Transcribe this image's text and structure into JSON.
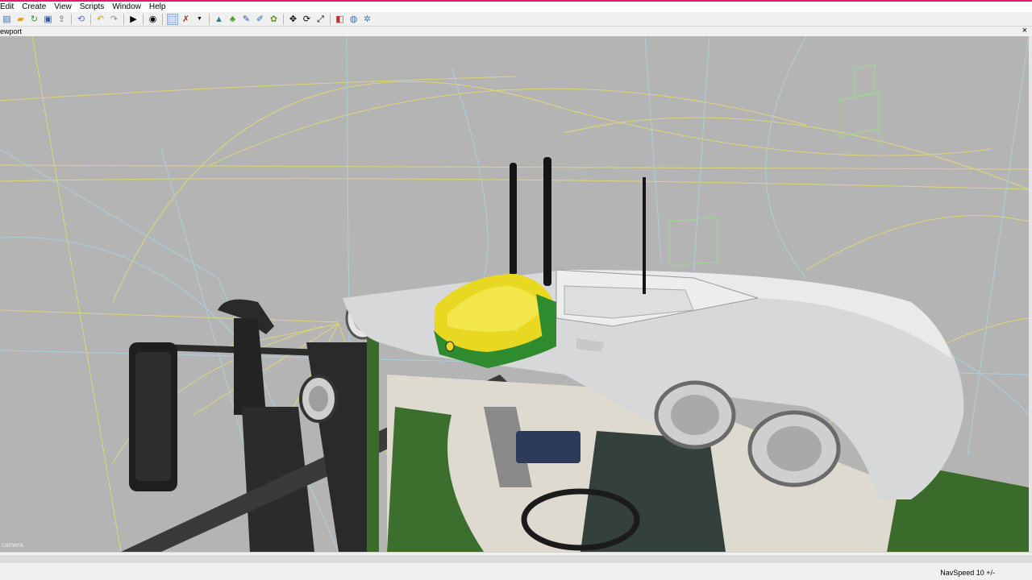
{
  "menu": [
    "Edit",
    "Create",
    "View",
    "Scripts",
    "Window",
    "Help"
  ],
  "toolbar_icons": [
    "new-file-icon",
    "open-file-icon",
    "reload-icon",
    "save-icon",
    "export-icon",
    "refresh-icon",
    "undo-icon",
    "redo-icon",
    "play-icon",
    "eye-icon",
    "select-icon",
    "paint-icon",
    "dropdown-icon",
    "terrain-icon",
    "foliage-icon",
    "paint-brush-icon",
    "brush-icon",
    "decoration-icon",
    "move-icon",
    "rotate-icon",
    "scale-icon",
    "cube-icon",
    "globe-icon",
    "settings-icon"
  ],
  "viewport": {
    "title": "ewport",
    "label": "camera",
    "close": "×"
  },
  "status": {
    "navspeed": "NavSpeed 10 +/-"
  },
  "colors": {
    "accent": "#e8186c",
    "deere_green": "#2e8b2e",
    "deere_yellow": "#e8d822",
    "viewport_bg": "#b4b4b4"
  }
}
